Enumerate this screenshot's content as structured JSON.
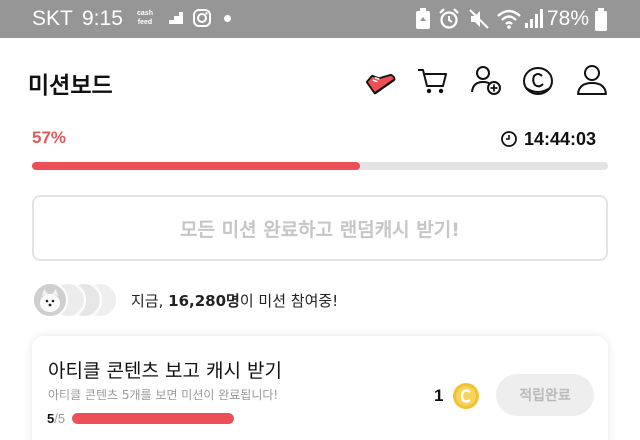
{
  "status_bar": {
    "carrier": "SKT",
    "time": "9:15",
    "cash_label_line1": "cash",
    "cash_label_line2": "feed",
    "battery": "78%",
    "icons": [
      "cashfeed-icon",
      "gallery-icon",
      "instagram-icon",
      "notification-dot-icon",
      "recycle-icon",
      "alarm-icon",
      "mute-icon",
      "wifi-icon",
      "signal-icon",
      "battery-icon"
    ]
  },
  "header": {
    "title": "미션보드",
    "icons": [
      "sneaker-icon",
      "cart-icon",
      "add-friend-icon",
      "coin-icon",
      "profile-icon"
    ],
    "accent_color": "#ec4f55"
  },
  "progress": {
    "percent_label": "57%",
    "percent": 57,
    "timer": "14:44:03"
  },
  "reward_button": {
    "label": "모든 미션 완료하고 랜덤캐시 받기!"
  },
  "participants": {
    "prefix": "지금,",
    "count": "16,280명",
    "suffix": "이 미션 참여중!"
  },
  "mission": {
    "title": "아티클 콘텐츠 보고 캐시 받기",
    "subtitle": "아티클 콘텐츠 5개를 보면 미션이 완료됩니다!",
    "done_count": "5",
    "total_count": "/5",
    "progress": 1.0,
    "reward": "1",
    "button_label": "적립완료"
  }
}
